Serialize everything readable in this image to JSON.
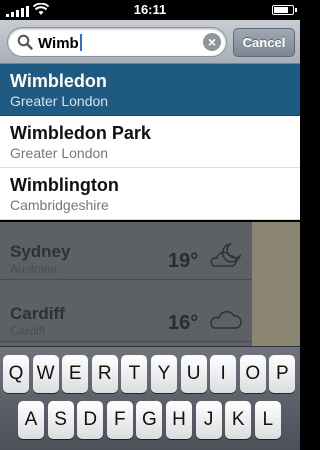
{
  "status_bar": {
    "time": "16:11",
    "battery_level": 0.75
  },
  "search": {
    "query": "Wimb",
    "cancel_label": "Cancel",
    "clear_icon": "×"
  },
  "results": [
    {
      "name": "Wimbledon",
      "region": "Greater London",
      "selected": true
    },
    {
      "name": "Wimbledon Park",
      "region": "Greater London",
      "selected": false
    },
    {
      "name": "Wimblington",
      "region": "Cambridgeshire",
      "selected": false
    }
  ],
  "background_list": [
    {
      "city": "Sydney",
      "country": "Australia",
      "temp": "19°",
      "icon": "partly-cloudy-night-icon"
    },
    {
      "city": "Cardiff",
      "country": "Cardiff",
      "temp": "16°",
      "icon": "cloud-icon"
    }
  ],
  "keyboard": {
    "row1": [
      "Q",
      "W",
      "E",
      "R",
      "T",
      "Y",
      "U",
      "I",
      "O",
      "P"
    ],
    "row2": [
      "A",
      "S",
      "D",
      "F",
      "G",
      "H",
      "J",
      "K",
      "L"
    ]
  }
}
